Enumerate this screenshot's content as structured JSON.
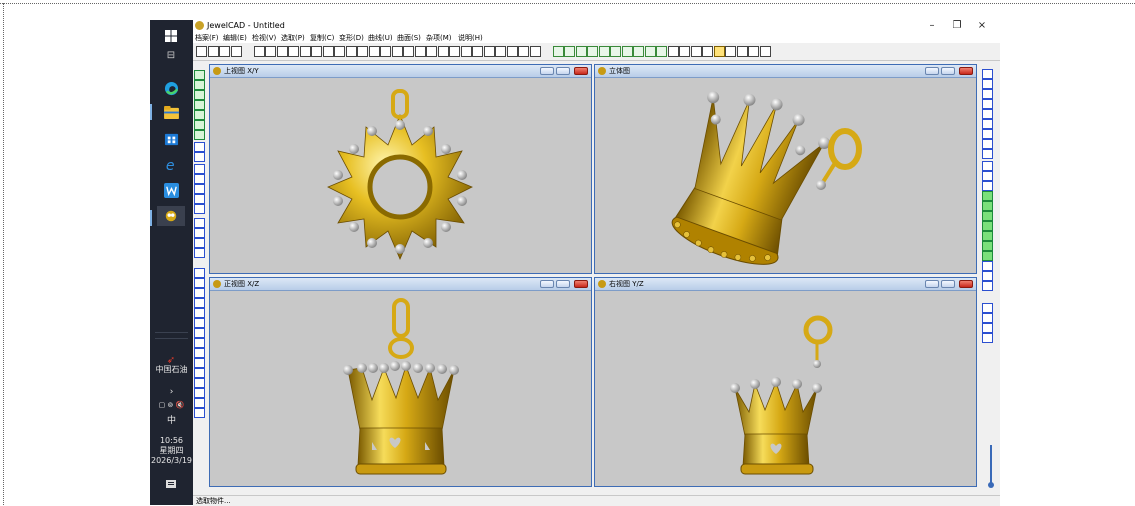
{
  "window": {
    "title": "JewelCAD - Untitled",
    "minimize": "–",
    "maximize": "❐",
    "close": "×"
  },
  "menu": [
    "档案(F)",
    "编辑(E)",
    "检视(V)",
    "选取(P)",
    "复制(C)",
    "变形(D)",
    "曲线(U)",
    "曲面(S)",
    "杂项(M)",
    "说明(H)"
  ],
  "viewports": [
    {
      "title": "上视图 X/Y"
    },
    {
      "title": "立体图"
    },
    {
      "title": "正视图 X/Z"
    },
    {
      "title": "右视图 Y/Z"
    }
  ],
  "status": {
    "text": "选取物件..."
  },
  "taskbar": {
    "company": "中国石油",
    "ime": "中",
    "time": "10:56",
    "weekday": "星期四",
    "date": "2026/3/19",
    "tray_icons": "▢ ⊚ 🔇"
  },
  "colors": {
    "viewport_bg": "#c8c8c8",
    "gold": "#d6a915",
    "gold_dark": "#8a6a00",
    "pearl": "#e8e8e8",
    "taskbar": "#1f2430"
  }
}
